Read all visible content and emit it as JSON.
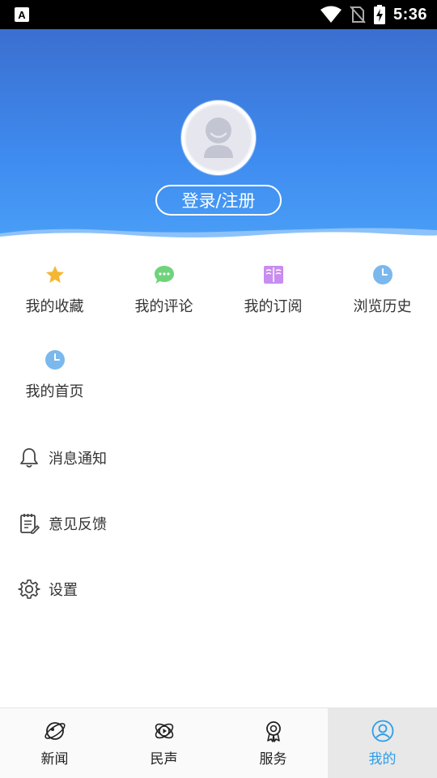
{
  "status_bar": {
    "time": "5:36",
    "icons": [
      "app-notification-icon",
      "wifi-icon",
      "no-sim-icon",
      "battery-charging-icon"
    ]
  },
  "header": {
    "login_label": "登录/注册",
    "avatar_icon": "default-avatar-icon",
    "gradient_top": "#3b6fcf",
    "gradient_bottom": "#4aa0f7"
  },
  "grid": {
    "items": [
      {
        "label": "我的收藏",
        "icon": "star-icon",
        "color": "#f4b731"
      },
      {
        "label": "我的评论",
        "icon": "comment-bubble-icon",
        "color": "#6fd37c"
      },
      {
        "label": "我的订阅",
        "icon": "open-book-icon",
        "color": "#c88df0"
      },
      {
        "label": "浏览历史",
        "icon": "clock-icon",
        "color": "#7ab8ee"
      },
      {
        "label": "我的首页",
        "icon": "clock-icon",
        "color": "#7ab8ee"
      }
    ]
  },
  "menu": {
    "items": [
      {
        "label": "消息通知",
        "icon": "bell-icon"
      },
      {
        "label": "意见反馈",
        "icon": "clipboard-edit-icon"
      },
      {
        "label": "设置",
        "icon": "gear-icon"
      }
    ]
  },
  "bottom_nav": {
    "active_color": "#2d9de8",
    "items": [
      {
        "label": "新闻",
        "icon": "planet-icon"
      },
      {
        "label": "民声",
        "icon": "atom-play-icon"
      },
      {
        "label": "服务",
        "icon": "award-ribbon-icon"
      },
      {
        "label": "我的",
        "icon": "user-circle-icon"
      }
    ]
  }
}
